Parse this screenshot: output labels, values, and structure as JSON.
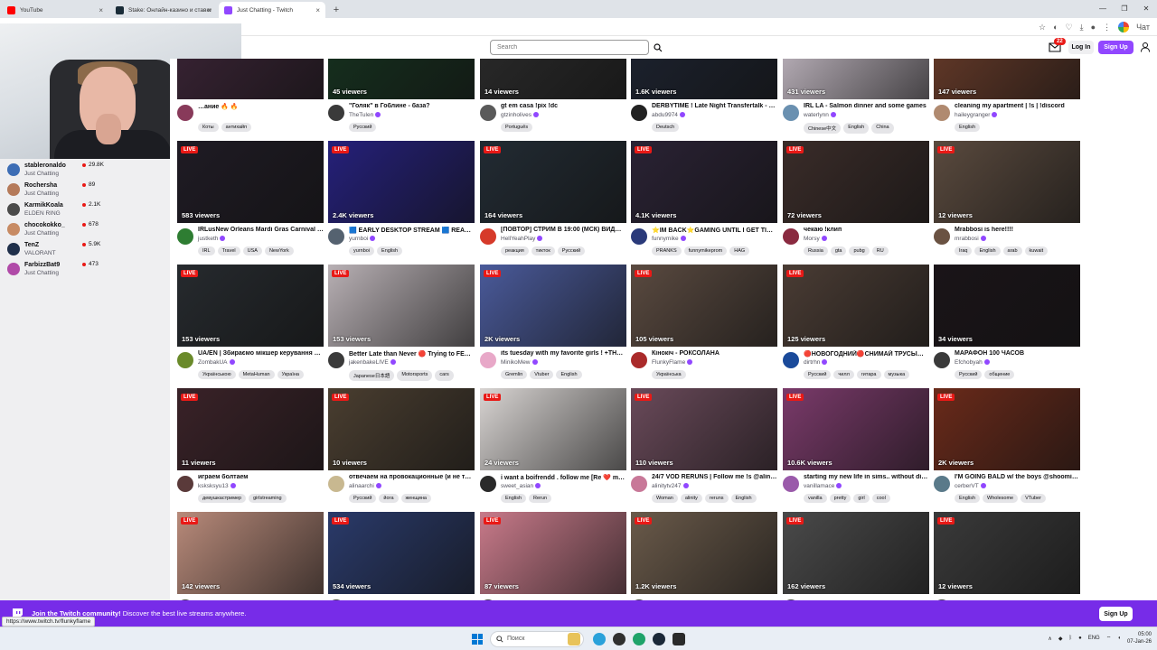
{
  "browser": {
    "tabs": [
      {
        "title": "YouTube",
        "color": "#ff0000",
        "active": false
      },
      {
        "title": "Stake: Онлайн-казино и ставки н…",
        "color": "#1a2c38",
        "active": false
      },
      {
        "title": "Just Chatting - Twitch",
        "color": "#9147ff",
        "active": true
      }
    ],
    "new_tab": "+",
    "win_controls": [
      "—",
      "❐",
      "✕"
    ],
    "profile_label": "Чат"
  },
  "nav": {
    "search_placeholder": "Search",
    "notif_count": "22",
    "login_label": "Log In",
    "signup_label": "Sign Up"
  },
  "sidebar": {
    "channels": [
      {
        "name": "stableronaldo",
        "category": "Just Chatting",
        "viewers": "29.8K",
        "color": "#3d6db5"
      },
      {
        "name": "Rochersha",
        "category": "Just Chatting",
        "viewers": "89",
        "color": "#b57a5a"
      },
      {
        "name": "KarmikKoala",
        "category": "ELDEN RING",
        "viewers": "2.1K",
        "color": "#4a4a4a"
      },
      {
        "name": "chocokokko_",
        "category": "Just Chatting",
        "viewers": "678",
        "color": "#c78a63"
      },
      {
        "name": "TenZ",
        "category": "VALORANT",
        "viewers": "5.9K",
        "color": "#1f2f4a"
      },
      {
        "name": "FarbizzBat9",
        "category": "Just Chatting",
        "viewers": "473",
        "color": "#b04aa8"
      }
    ]
  },
  "cards": [
    {
      "viewers": "",
      "title": "…ание 🔥 🔥",
      "name": "",
      "tags": [
        "Коты",
        "антихайп"
      ],
      "bg": "#3b2436",
      "av": "#883a5a",
      "live": false
    },
    {
      "viewers": "45 viewers",
      "title": "\"Голяк\" в Гоблине - база?",
      "name": "TheTulen",
      "tags": [
        "Русский"
      ],
      "bg": "#16321f",
      "av": "#3a3a3a",
      "live": false
    },
    {
      "viewers": "14 viewers",
      "title": "gt em casa !pix !dc",
      "name": "gtzinholives",
      "tags": [
        "Português"
      ],
      "bg": "#2b2b2b",
      "av": "#5a5a5a",
      "live": false
    },
    {
      "viewers": "1.6K viewers",
      "title": "DERBYTIME ! Late Night Transfertalk - …",
      "name": "abdu9974",
      "tags": [
        "Deutsch"
      ],
      "bg": "#1d2330",
      "av": "#222222",
      "live": false
    },
    {
      "viewers": "431 viewers",
      "title": "IRL LA - Salmon dinner and some games",
      "name": "waterlynn",
      "tags": [
        "Chinese中文",
        "English",
        "China"
      ],
      "bg": "#c9bfc9",
      "av": "#6a90b0",
      "live": false
    },
    {
      "viewers": "147 viewers",
      "title": "cleaning my apartment | !s | !discord",
      "name": "haileygranger",
      "tags": [
        "English"
      ],
      "bg": "#6a3c2a",
      "av": "#b08a70",
      "live": false
    },
    {
      "viewers": "583 viewers",
      "title": "IRLusNew Orleans Mardi Gras Carnival …",
      "name": "justketh",
      "tags": [
        "IRL",
        "Travel",
        "USA",
        "NewYork"
      ],
      "bg": "#1f1b24",
      "av": "#2e7d32",
      "live": true
    },
    {
      "viewers": "2.4K viewers",
      "title": "🟦 EARLY DESKTOP STREAM 🟦 REAC…",
      "name": "yurnboi",
      "tags": [
        "yurnboi",
        "English"
      ],
      "bg": "#25207a",
      "av": "#556270",
      "live": true
    },
    {
      "viewers": "164 viewers",
      "title": "[ПОВТОР] СТРИМ В 19:00 (МСК) ВИД…",
      "name": "HellYeahPlay",
      "tags": [
        "реакция",
        "тикток",
        "Русский"
      ],
      "bg": "#222b33",
      "av": "#d63a2a",
      "live": true
    },
    {
      "viewers": "4.1K viewers",
      "title": "⭐IM BACK⭐GAMING UNTIL I GET TIR…",
      "name": "funnymike",
      "tags": [
        "PRANKS",
        "funnymikeprom",
        "HAG"
      ],
      "bg": "#2a2234",
      "av": "#2a3a7a",
      "live": true
    },
    {
      "viewers": "72 viewers",
      "title": "чекаю !клип",
      "name": "Morsy",
      "tags": [
        "Russia",
        "gta",
        "pubg",
        "RU"
      ],
      "bg": "#3a2c29",
      "av": "#8a2a40",
      "live": true
    },
    {
      "viewers": "12 viewers",
      "title": "Mrabbosi is here!!!!",
      "name": "mrabbosi",
      "tags": [
        "Iraq",
        "English",
        "arab",
        "kuwait"
      ],
      "bg": "#5a4a3e",
      "av": "#6a5242",
      "live": true
    },
    {
      "viewers": "153 viewers",
      "title": "UA/EN | Збираємо мікшер керування …",
      "name": "ZombakUA",
      "tags": [
        "Українською",
        "MetaHuman",
        "Україна"
      ],
      "bg": "#262a2e",
      "av": "#6a8a2a",
      "live": true
    },
    {
      "viewers": "153 viewers",
      "title": "Better Late than Never 🔴 Trying to FE…",
      "name": "jakenbakeLIVE",
      "tags": [
        "Japanese日本語",
        "Motorsports",
        "cars"
      ],
      "bg": "#b8b0b4",
      "av": "#3a3a3a",
      "live": true
    },
    {
      "viewers": "2K viewers",
      "title": "its tuesday with my favorite girls ! +TH…",
      "name": "MinikoMew",
      "tags": [
        "Gremlin",
        "Vtuber",
        "English"
      ],
      "bg": "#4a5a9a",
      "av": "#e8a8c8",
      "live": true
    },
    {
      "viewers": "105 viewers",
      "title": "Кінокіч - РОКСОЛАНА",
      "name": "FlunkyFlame",
      "tags": [
        "Українська"
      ],
      "bg": "#5a4a40",
      "av": "#aa2a2a",
      "live": true
    },
    {
      "viewers": "125 viewers",
      "title": "🔴НОВОГОДНИЙ🔴СНИМАЙ ТРУСЫ…",
      "name": "dirtrhn",
      "tags": [
        "Русский",
        "чилл",
        "гитара",
        "музыка"
      ],
      "bg": "#4a3c34",
      "av": "#1a4a9a",
      "live": true
    },
    {
      "viewers": "34 viewers",
      "title": "МАРАФОН 100 ЧАСОВ",
      "name": "Efchobyah",
      "tags": [
        "Русский",
        "общение"
      ],
      "bg": "#1a1418",
      "av": "#3a3a3a",
      "live": false
    },
    {
      "viewers": "11 viewers",
      "title": "играем болтаем",
      "name": "ksksksyu13",
      "tags": [
        "девушкастример",
        "girlstreaming"
      ],
      "bg": "#3a2228",
      "av": "#5a3a3a",
      "live": true
    },
    {
      "viewers": "10 viewers",
      "title": "отвечаем на провокационные (и не т…",
      "name": "alinaarchi",
      "tags": [
        "Русский",
        "йога",
        "женщина"
      ],
      "bg": "#4a3e30",
      "av": "#c8b890",
      "live": true
    },
    {
      "viewers": "24 viewers",
      "title": "i want a boifrendd . follow me [Re ❤️ m…",
      "name": "sweet_asian",
      "tags": [
        "English",
        "Rerun"
      ],
      "bg": "#d8d4d2",
      "av": "#2a2a2a",
      "live": true
    },
    {
      "viewers": "110 viewers",
      "title": "24/7 VOD RERUNS | Follow me !s @alini…",
      "name": "alinitytv247",
      "tags": [
        "Woman",
        "alinity",
        "reruns",
        "English"
      ],
      "bg": "#6a4a5a",
      "av": "#c87898",
      "live": true
    },
    {
      "viewers": "10.6K viewers",
      "title": "starting my new life in sims.. without di…",
      "name": "vanillamace",
      "tags": [
        "vanilla",
        "pretty",
        "girl",
        "cool"
      ],
      "bg": "#7a3a6a",
      "av": "#9a5aaa",
      "live": true
    },
    {
      "viewers": "2K viewers",
      "title": "I'M GOING BALD w/ the boys @shoomi…",
      "name": "cerberVT",
      "tags": [
        "English",
        "Wholesome",
        "VTuber"
      ],
      "bg": "#6a2a1a",
      "av": "#5a7a8a",
      "live": true
    },
    {
      "viewers": "142 viewers",
      "title": "",
      "name": "",
      "tags": [],
      "bg": "#b88a7a",
      "av": "#444444",
      "live": true
    },
    {
      "viewers": "534 viewers",
      "title": "",
      "name": "",
      "tags": [],
      "bg": "#2a3a6a",
      "av": "#444444",
      "live": true
    },
    {
      "viewers": "87 viewers",
      "title": "",
      "name": "",
      "tags": [],
      "bg": "#c87a8a",
      "av": "#444444",
      "live": true
    },
    {
      "viewers": "1.2K viewers",
      "title": "",
      "name": "",
      "tags": [],
      "bg": "#6a5a4a",
      "av": "#444444",
      "live": true
    },
    {
      "viewers": "162 viewers",
      "title": "",
      "name": "",
      "tags": [],
      "bg": "#4a4a4a",
      "av": "#444444",
      "live": true
    },
    {
      "viewers": "12 viewers",
      "title": "",
      "name": "",
      "tags": [],
      "bg": "#3a3a3a",
      "av": "#444444",
      "live": true
    }
  ],
  "banner": {
    "strong": "Join the Twitch community!",
    "text": " Discover the best live streams anywhere.",
    "signup_label": "Sign Up",
    "url_tooltip": "https://www.twitch.tv/flunkyflame"
  },
  "taskbar": {
    "search_label": "Поиск",
    "lang": "ENG",
    "time": "05:00",
    "date": "07-Jan-26"
  },
  "accent": "#9147ff",
  "banner_color": "#772ce8"
}
